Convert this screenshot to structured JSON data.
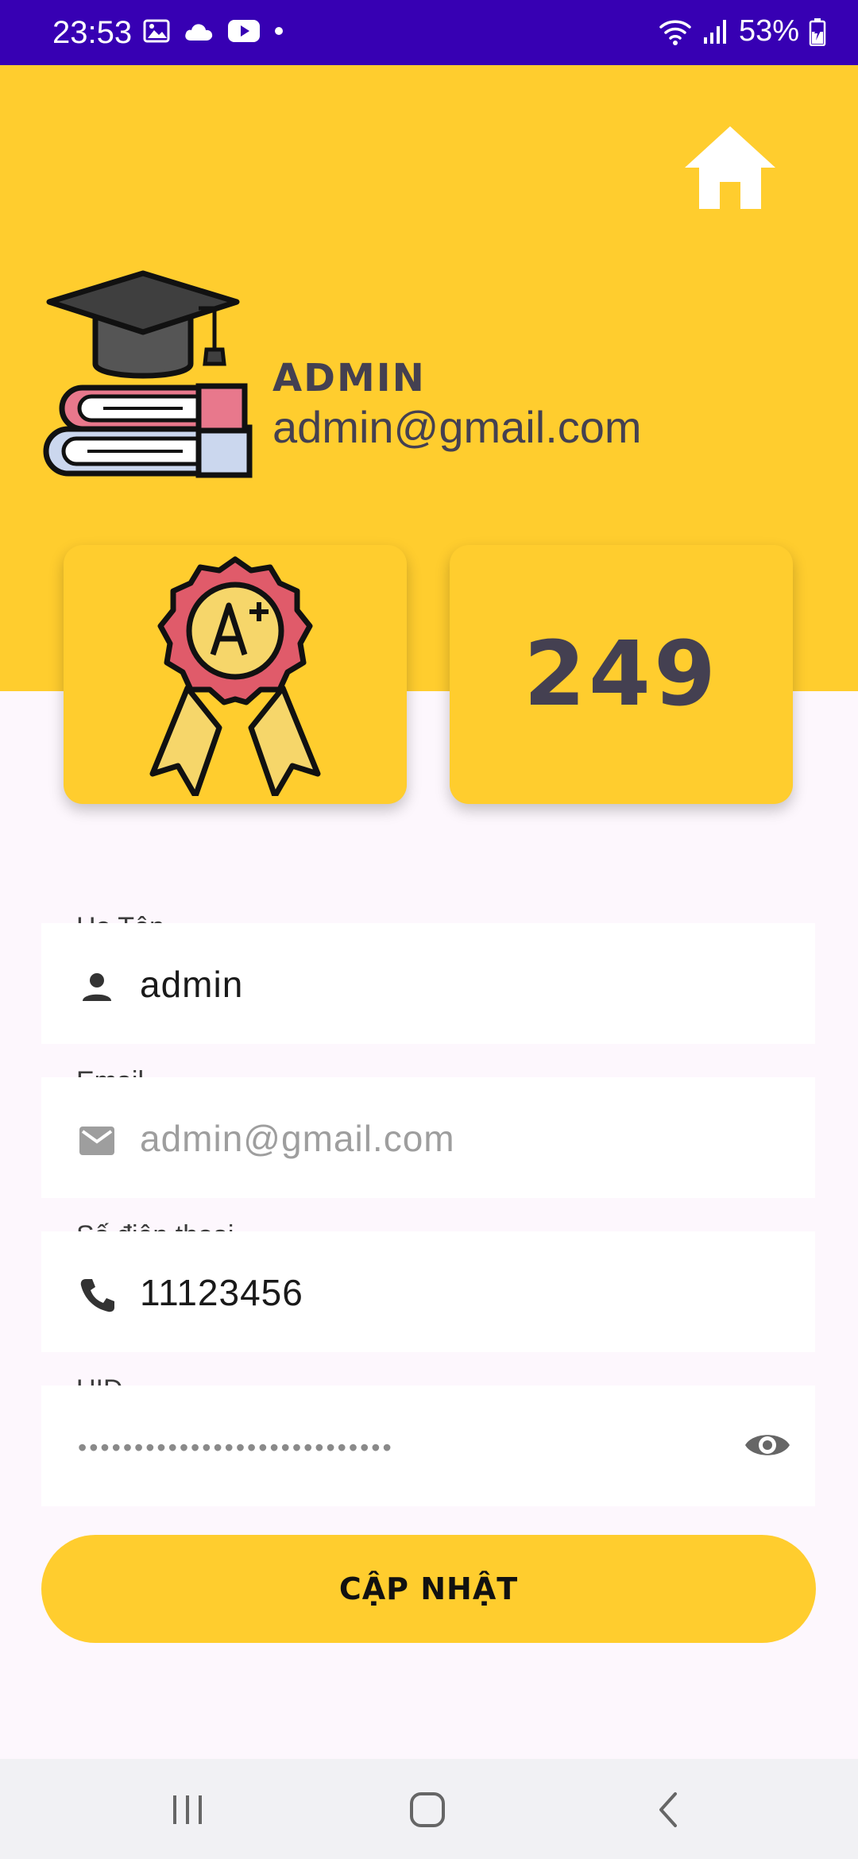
{
  "status_bar": {
    "time": "23:53",
    "battery": "53%",
    "left_icons": [
      "image-icon",
      "cloud-icon",
      "youtube-icon",
      "dot-icon"
    ],
    "right_icons": [
      "wifi-icon",
      "signal-icon",
      "battery-charging-icon"
    ]
  },
  "profile": {
    "name": "ADMIN",
    "email": "admin@gmail.com"
  },
  "stats": {
    "score": "249"
  },
  "form": {
    "name_label": "Họ Tên",
    "name_value": "admin",
    "email_label": "Email",
    "email_value": "admin@gmail.com",
    "phone_label": "Số điện thoại",
    "phone_value": "11123456",
    "uid_label": "UID",
    "uid_value": "••••••••••••••••••••••••••••"
  },
  "actions": {
    "update_label": "CẬP NHẬT"
  },
  "colors": {
    "status_bar": "#3700B3",
    "accent": "#FFCD2E",
    "text_dark": "#444051",
    "background": "#FDF7FD"
  }
}
